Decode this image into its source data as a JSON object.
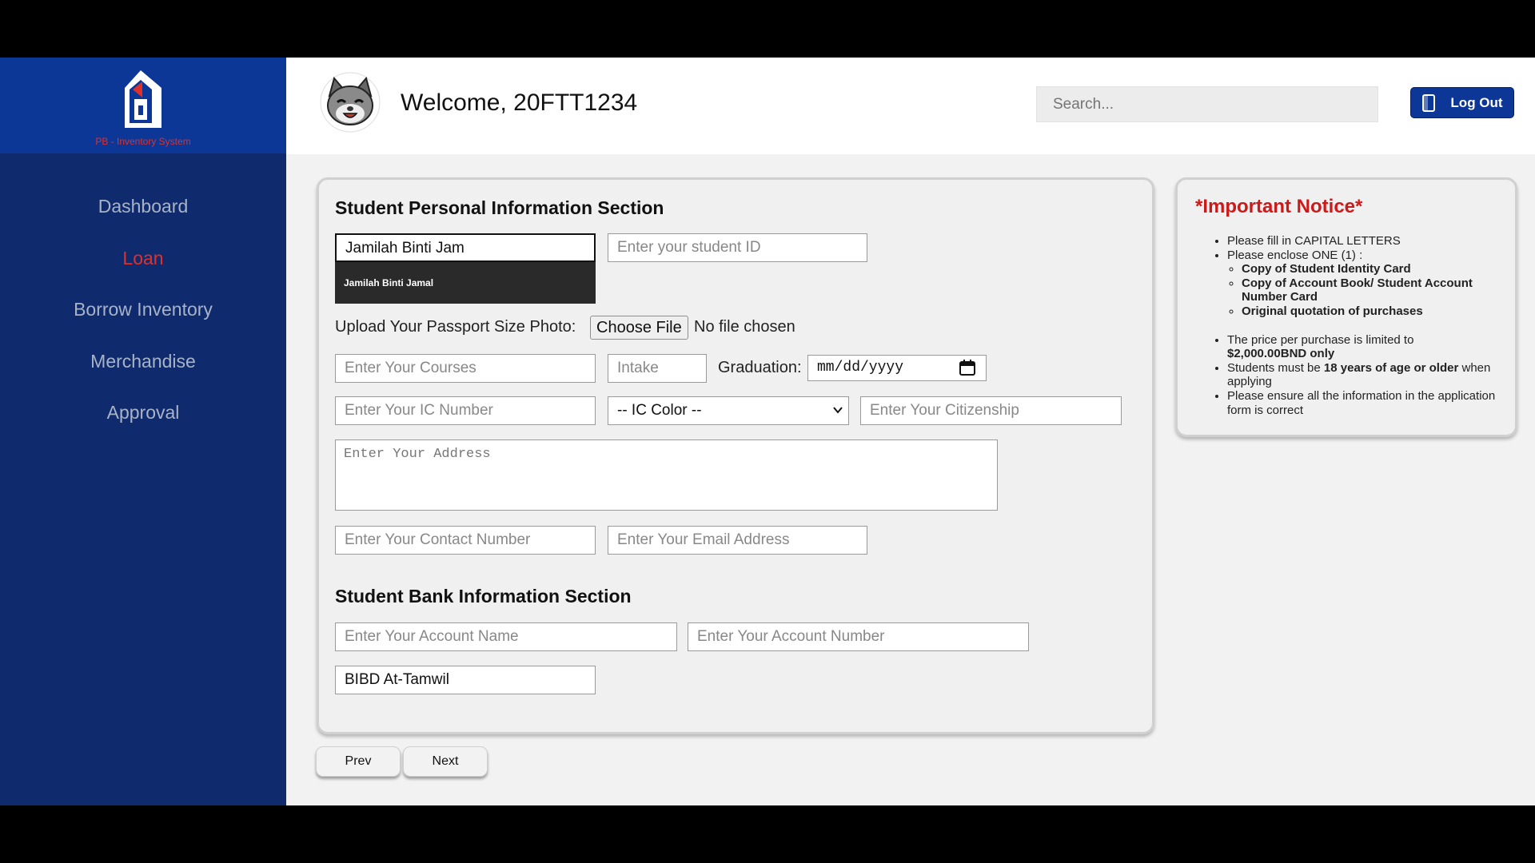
{
  "sidebar": {
    "logo_text": "PB - Inventory System",
    "items": [
      {
        "label": "Dashboard",
        "active": false
      },
      {
        "label": "Loan",
        "active": true
      },
      {
        "label": "Borrow Inventory",
        "active": false
      },
      {
        "label": "Merchandise",
        "active": false
      },
      {
        "label": "Approval",
        "active": false
      }
    ]
  },
  "header": {
    "welcome": "Welcome, 20FTT1234",
    "search_placeholder": "Search...",
    "logout_label": "Log Out"
  },
  "form": {
    "personal_title": "Student Personal Information Section",
    "name_value": "Jamilah Binti Jam",
    "name_suggestion": "Jamilah Binti Jamal",
    "student_id_placeholder": "Enter your student ID",
    "upload_label": "Upload Your Passport Size Photo:",
    "choose_file_label": "Choose File",
    "no_file_text": "No file chosen",
    "courses_placeholder": "Enter Your Courses",
    "intake_placeholder": "Intake",
    "graduation_label": "Graduation:",
    "date_placeholder": "mm/dd/yyyy",
    "ic_number_placeholder": "Enter Your IC Number",
    "ic_color_selected": "-- IC Color --",
    "citizenship_placeholder": "Enter Your Citizenship",
    "address_placeholder": "Enter Your Address",
    "contact_placeholder": "Enter Your Contact Number",
    "email_placeholder": "Enter Your Email Address",
    "bank_title": "Student Bank Information Section",
    "account_name_placeholder": "Enter Your Account Name",
    "account_number_placeholder": "Enter Your Account Number",
    "bank_value": "BIBD At-Tamwil"
  },
  "nav_buttons": {
    "prev": "Prev",
    "next": "Next"
  },
  "notice": {
    "title": "*Important Notice*",
    "item1": "Please fill in CAPITAL LETTERS",
    "item2": "Please enclose ONE (1) :",
    "sub1": "Copy of Student Identity Card",
    "sub2": "Copy of Account Book/ Student Account Number Card",
    "sub3": "Original quotation of purchases",
    "item3_pre": "The price per purchase is limited to",
    "item3_bold": "$2,000.00BND only",
    "item4_pre": "Students must be",
    "item4_bold": "18 years of age or older",
    "item4_post": "when applying",
    "item5": "Please ensure all the information in the application form is correct"
  },
  "colors": {
    "sidebar": "#0f2b6e",
    "logo_bg": "#0d3796",
    "accent_red": "#e0302a",
    "logout_bg": "#0d3796"
  }
}
